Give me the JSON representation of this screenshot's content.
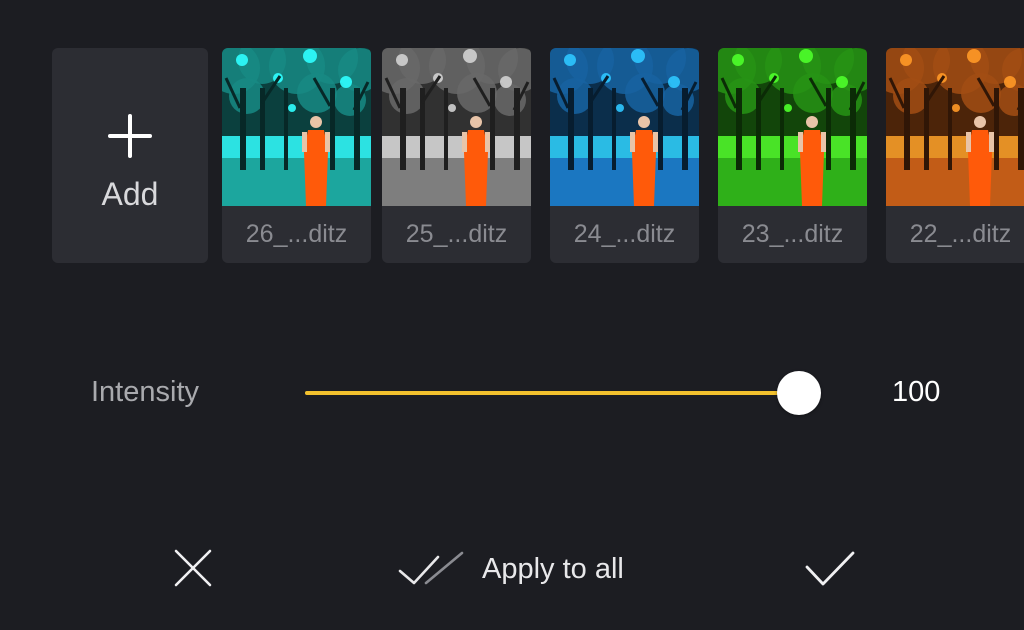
{
  "add_tile": {
    "label": "Add",
    "icon": "plus-icon"
  },
  "filters": [
    {
      "label": "26_...ditz",
      "tint": "#1fb8b0"
    },
    {
      "label": "25_...ditz",
      "tint": "#8c8c8c"
    },
    {
      "label": "24_...ditz",
      "tint": "#1e84d6"
    },
    {
      "label": "23_...ditz",
      "tint": "#34c41c"
    },
    {
      "label": "22_...ditz",
      "tint": "#d8661a"
    }
  ],
  "intensity": {
    "label": "Intensity",
    "value": 100,
    "value_text": "100",
    "max": 100,
    "fill_color": "#f2c12e"
  },
  "bottom_bar": {
    "cancel_icon": "close-icon",
    "apply_all_label": "Apply to all",
    "apply_all_icon": "double-check-icon",
    "confirm_icon": "checkmark-icon"
  },
  "colors": {
    "background": "#1c1d22",
    "tile_background": "#2c2d33",
    "subject_orange": "#ff5a0a"
  }
}
